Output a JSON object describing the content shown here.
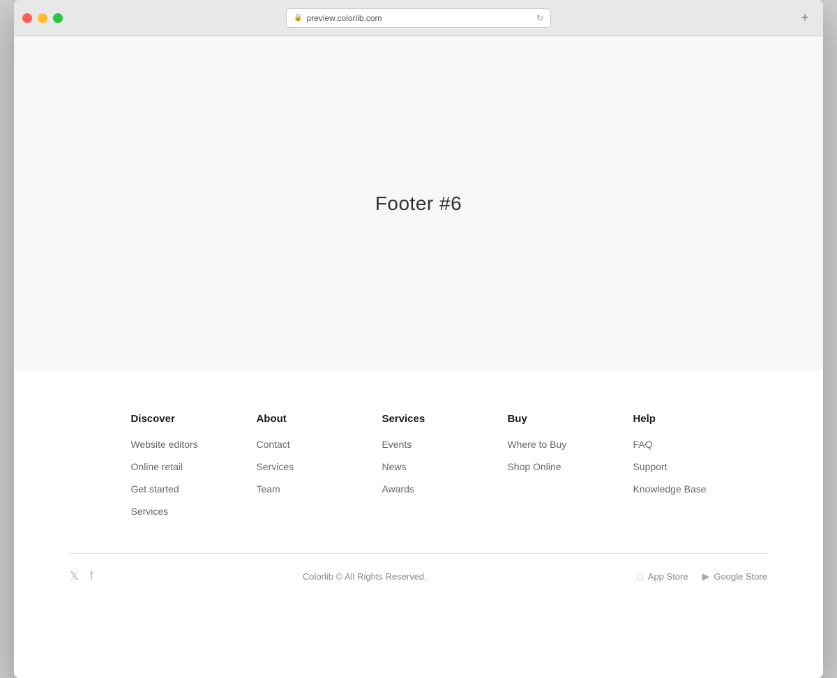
{
  "browser": {
    "address": "preview.colorlib.com",
    "new_tab_label": "+"
  },
  "main": {
    "title": "Footer #6"
  },
  "footer": {
    "columns": [
      {
        "heading": "Discover",
        "links": [
          "Website editors",
          "Online retail",
          "Get started",
          "Services"
        ]
      },
      {
        "heading": "About",
        "links": [
          "Contact",
          "Services",
          "Team"
        ]
      },
      {
        "heading": "Services",
        "links": [
          "Events",
          "News",
          "Awards"
        ]
      },
      {
        "heading": "Buy",
        "links": [
          "Where to Buy",
          "Shop Online"
        ]
      },
      {
        "heading": "Help",
        "links": [
          "FAQ",
          "Support",
          "Knowledge Base"
        ]
      }
    ],
    "copyright": "Colorlib © All Rights Reserved.",
    "app_store": "App Store",
    "google_store": "Google Store"
  }
}
